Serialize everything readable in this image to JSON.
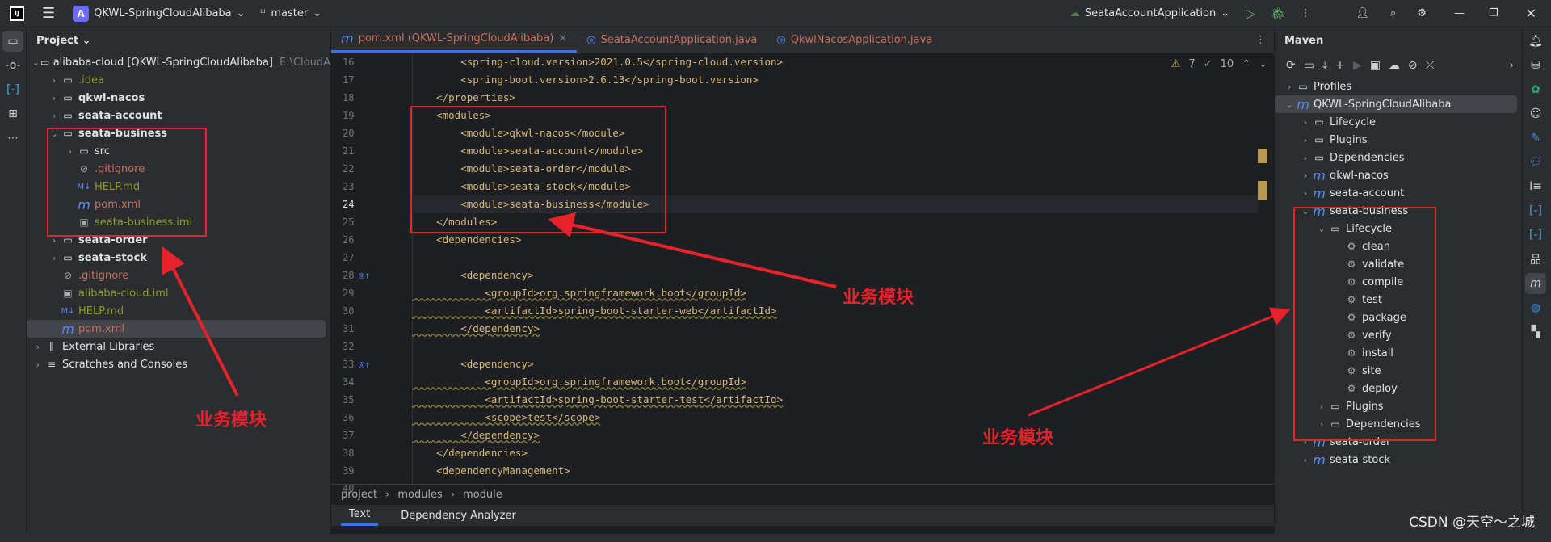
{
  "titlebar": {
    "project_badge": "A",
    "project_name": "QKWL-SpringCloudAlibaba",
    "branch": "master",
    "run_config": "SeataAccountApplication"
  },
  "project_panel": {
    "title": "Project",
    "tree": [
      {
        "label": "alibaba-cloud [QKWL-SpringCloudAlibaba]",
        "suffix": "E:\\CloudA",
        "depth": 0,
        "chev": "⌄",
        "icon": "module-folder-icon",
        "glyph": "▭",
        "color": "",
        "bold": false
      },
      {
        "label": ".idea",
        "depth": 1,
        "chev": "›",
        "icon": "folder-icon",
        "glyph": "▭",
        "color": "c-olive"
      },
      {
        "label": "qkwl-nacos",
        "depth": 1,
        "chev": "›",
        "icon": "module-folder-icon",
        "glyph": "▭",
        "color": "",
        "bold": true
      },
      {
        "label": "seata-account",
        "depth": 1,
        "chev": "›",
        "icon": "module-folder-icon",
        "glyph": "▭",
        "color": "",
        "bold": true
      },
      {
        "label": "seata-business",
        "depth": 1,
        "chev": "⌄",
        "icon": "module-folder-icon",
        "glyph": "▭",
        "color": "",
        "bold": true
      },
      {
        "label": "src",
        "depth": 2,
        "chev": "›",
        "icon": "folder-icon",
        "glyph": "▭",
        "color": ""
      },
      {
        "label": ".gitignore",
        "depth": 2,
        "chev": "",
        "icon": "ignore-icon",
        "glyph": "⊘",
        "color": "c-red"
      },
      {
        "label": "HELP.md",
        "depth": 2,
        "chev": "",
        "icon": "markdown-icon",
        "glyph": "M↓",
        "color": "c-olive"
      },
      {
        "label": "pom.xml",
        "depth": 2,
        "chev": "",
        "icon": "maven-icon",
        "glyph": "m",
        "color": "c-red"
      },
      {
        "label": "seata-business.iml",
        "depth": 2,
        "chev": "",
        "icon": "iml-file-icon",
        "glyph": "▣",
        "color": "c-olive"
      },
      {
        "label": "seata-order",
        "depth": 1,
        "chev": "›",
        "icon": "module-folder-icon",
        "glyph": "▭",
        "color": "",
        "bold": true
      },
      {
        "label": "seata-stock",
        "depth": 1,
        "chev": "›",
        "icon": "module-folder-icon",
        "glyph": "▭",
        "color": "",
        "bold": true
      },
      {
        "label": ".gitignore",
        "depth": 1,
        "chev": "",
        "icon": "ignore-icon",
        "glyph": "⊘",
        "color": "c-red"
      },
      {
        "label": "alibaba-cloud.iml",
        "depth": 1,
        "chev": "",
        "icon": "iml-file-icon",
        "glyph": "▣",
        "color": "c-olive"
      },
      {
        "label": "HELP.md",
        "depth": 1,
        "chev": "",
        "icon": "markdown-icon",
        "glyph": "M↓",
        "color": "c-olive"
      },
      {
        "label": "pom.xml",
        "depth": 1,
        "chev": "",
        "icon": "maven-icon",
        "glyph": "m",
        "color": "c-red",
        "selected": true
      },
      {
        "label": "External Libraries",
        "depth": 0,
        "chev": "›",
        "icon": "library-icon",
        "glyph": "⫼",
        "color": ""
      },
      {
        "label": "Scratches and Consoles",
        "depth": 0,
        "chev": "›",
        "icon": "scratches-icon",
        "glyph": "≡",
        "color": ""
      }
    ]
  },
  "editor": {
    "tabs": [
      {
        "label": "pom.xml (QKWL-SpringCloudAlibaba)",
        "icon": "maven-icon",
        "active": true
      },
      {
        "label": "SeataAccountApplication.java",
        "icon": "spring-class-icon"
      },
      {
        "label": "QkwlNacosApplication.java",
        "icon": "spring-class-icon"
      }
    ],
    "warnings": "7",
    "weak_warnings": "10",
    "lines": [
      {
        "n": "16",
        "code": "        <spring-cloud.version>2021.0.5</spring-cloud.version>"
      },
      {
        "n": "17",
        "code": "        <spring-boot.version>2.6.13</spring-boot.version>"
      },
      {
        "n": "18",
        "code": "    </properties>"
      },
      {
        "n": "19",
        "code": "    <modules>"
      },
      {
        "n": "20",
        "code": "        <module>qkwl-nacos</module>"
      },
      {
        "n": "21",
        "code": "        <module>seata-account</module>"
      },
      {
        "n": "22",
        "code": "        <module>seata-order</module>"
      },
      {
        "n": "23",
        "code": "        <module>seata-stock</module>"
      },
      {
        "n": "24",
        "code": "        <module>seata-business</module>",
        "current": true
      },
      {
        "n": "25",
        "code": "    </modules>"
      },
      {
        "n": "26",
        "code": "    <dependencies>"
      },
      {
        "n": "27",
        "code": ""
      },
      {
        "n": "28",
        "code": "        <dependency>",
        "gutter": true
      },
      {
        "n": "29",
        "code": "            <groupId>org.springframework.boot</groupId>",
        "wavy": true
      },
      {
        "n": "30",
        "code": "            <artifactId>spring-boot-starter-web</artifactId>",
        "wavy": true
      },
      {
        "n": "31",
        "code": "        </dependency>",
        "wavy": true
      },
      {
        "n": "32",
        "code": ""
      },
      {
        "n": "33",
        "code": "        <dependency>",
        "gutter": true
      },
      {
        "n": "34",
        "code": "            <groupId>org.springframework.boot</groupId>",
        "wavy": true
      },
      {
        "n": "35",
        "code": "            <artifactId>spring-boot-starter-test</artifactId>",
        "wavy": true
      },
      {
        "n": "36",
        "code": "            <scope>test</scope>",
        "wavy": true
      },
      {
        "n": "37",
        "code": "        </dependency>",
        "wavy": true
      },
      {
        "n": "38",
        "code": "    </dependencies>"
      },
      {
        "n": "39",
        "code": "    <dependencyManagement>"
      },
      {
        "n": "40",
        "code": "        <dependencies>"
      }
    ],
    "breadcrumbs": [
      "project",
      "modules",
      "module"
    ],
    "bottom_tabs": [
      {
        "label": "Text",
        "active": true
      },
      {
        "label": "Dependency Analyzer"
      }
    ]
  },
  "maven": {
    "title": "Maven",
    "tree": [
      {
        "label": "Profiles",
        "depth": 0,
        "chev": "›",
        "icon": "profiles-folder-icon",
        "glyph": "▭"
      },
      {
        "label": "QKWL-SpringCloudAlibaba",
        "depth": 0,
        "chev": "⌄",
        "icon": "maven-icon",
        "glyph": "m",
        "selected": true
      },
      {
        "label": "Lifecycle",
        "depth": 1,
        "chev": "›",
        "icon": "lifecycle-folder-icon",
        "glyph": "▭"
      },
      {
        "label": "Plugins",
        "depth": 1,
        "chev": "›",
        "icon": "plugins-folder-icon",
        "glyph": "▭"
      },
      {
        "label": "Dependencies",
        "depth": 1,
        "chev": "›",
        "icon": "dependencies-folder-icon",
        "glyph": "▭"
      },
      {
        "label": "qkwl-nacos",
        "depth": 1,
        "chev": "›",
        "icon": "maven-icon",
        "glyph": "m"
      },
      {
        "label": "seata-account",
        "depth": 1,
        "chev": "›",
        "icon": "maven-icon",
        "glyph": "m"
      },
      {
        "label": "seata-business",
        "depth": 1,
        "chev": "⌄",
        "icon": "maven-icon",
        "glyph": "m"
      },
      {
        "label": "Lifecycle",
        "depth": 2,
        "chev": "⌄",
        "icon": "lifecycle-folder-icon",
        "glyph": "▭"
      },
      {
        "label": "clean",
        "depth": 3,
        "chev": "",
        "icon": "gear-icon",
        "glyph": "⚙"
      },
      {
        "label": "validate",
        "depth": 3,
        "chev": "",
        "icon": "gear-icon",
        "glyph": "⚙"
      },
      {
        "label": "compile",
        "depth": 3,
        "chev": "",
        "icon": "gear-icon",
        "glyph": "⚙"
      },
      {
        "label": "test",
        "depth": 3,
        "chev": "",
        "icon": "gear-icon",
        "glyph": "⚙"
      },
      {
        "label": "package",
        "depth": 3,
        "chev": "",
        "icon": "gear-icon",
        "glyph": "⚙"
      },
      {
        "label": "verify",
        "depth": 3,
        "chev": "",
        "icon": "gear-icon",
        "glyph": "⚙"
      },
      {
        "label": "install",
        "depth": 3,
        "chev": "",
        "icon": "gear-icon",
        "glyph": "⚙"
      },
      {
        "label": "site",
        "depth": 3,
        "chev": "",
        "icon": "gear-icon",
        "glyph": "⚙"
      },
      {
        "label": "deploy",
        "depth": 3,
        "chev": "",
        "icon": "gear-icon",
        "glyph": "⚙"
      },
      {
        "label": "Plugins",
        "depth": 2,
        "chev": "›",
        "icon": "plugins-folder-icon",
        "glyph": "▭"
      },
      {
        "label": "Dependencies",
        "depth": 2,
        "chev": "›",
        "icon": "dependencies-folder-icon",
        "glyph": "▭"
      },
      {
        "label": "seata-order",
        "depth": 1,
        "chev": "›",
        "icon": "maven-icon",
        "glyph": "m"
      },
      {
        "label": "seata-stock",
        "depth": 1,
        "chev": "›",
        "icon": "maven-icon",
        "glyph": "m"
      }
    ]
  },
  "annotations": {
    "label": "业务模块",
    "color": "#e8222b"
  },
  "watermark": "CSDN @天空～之城"
}
